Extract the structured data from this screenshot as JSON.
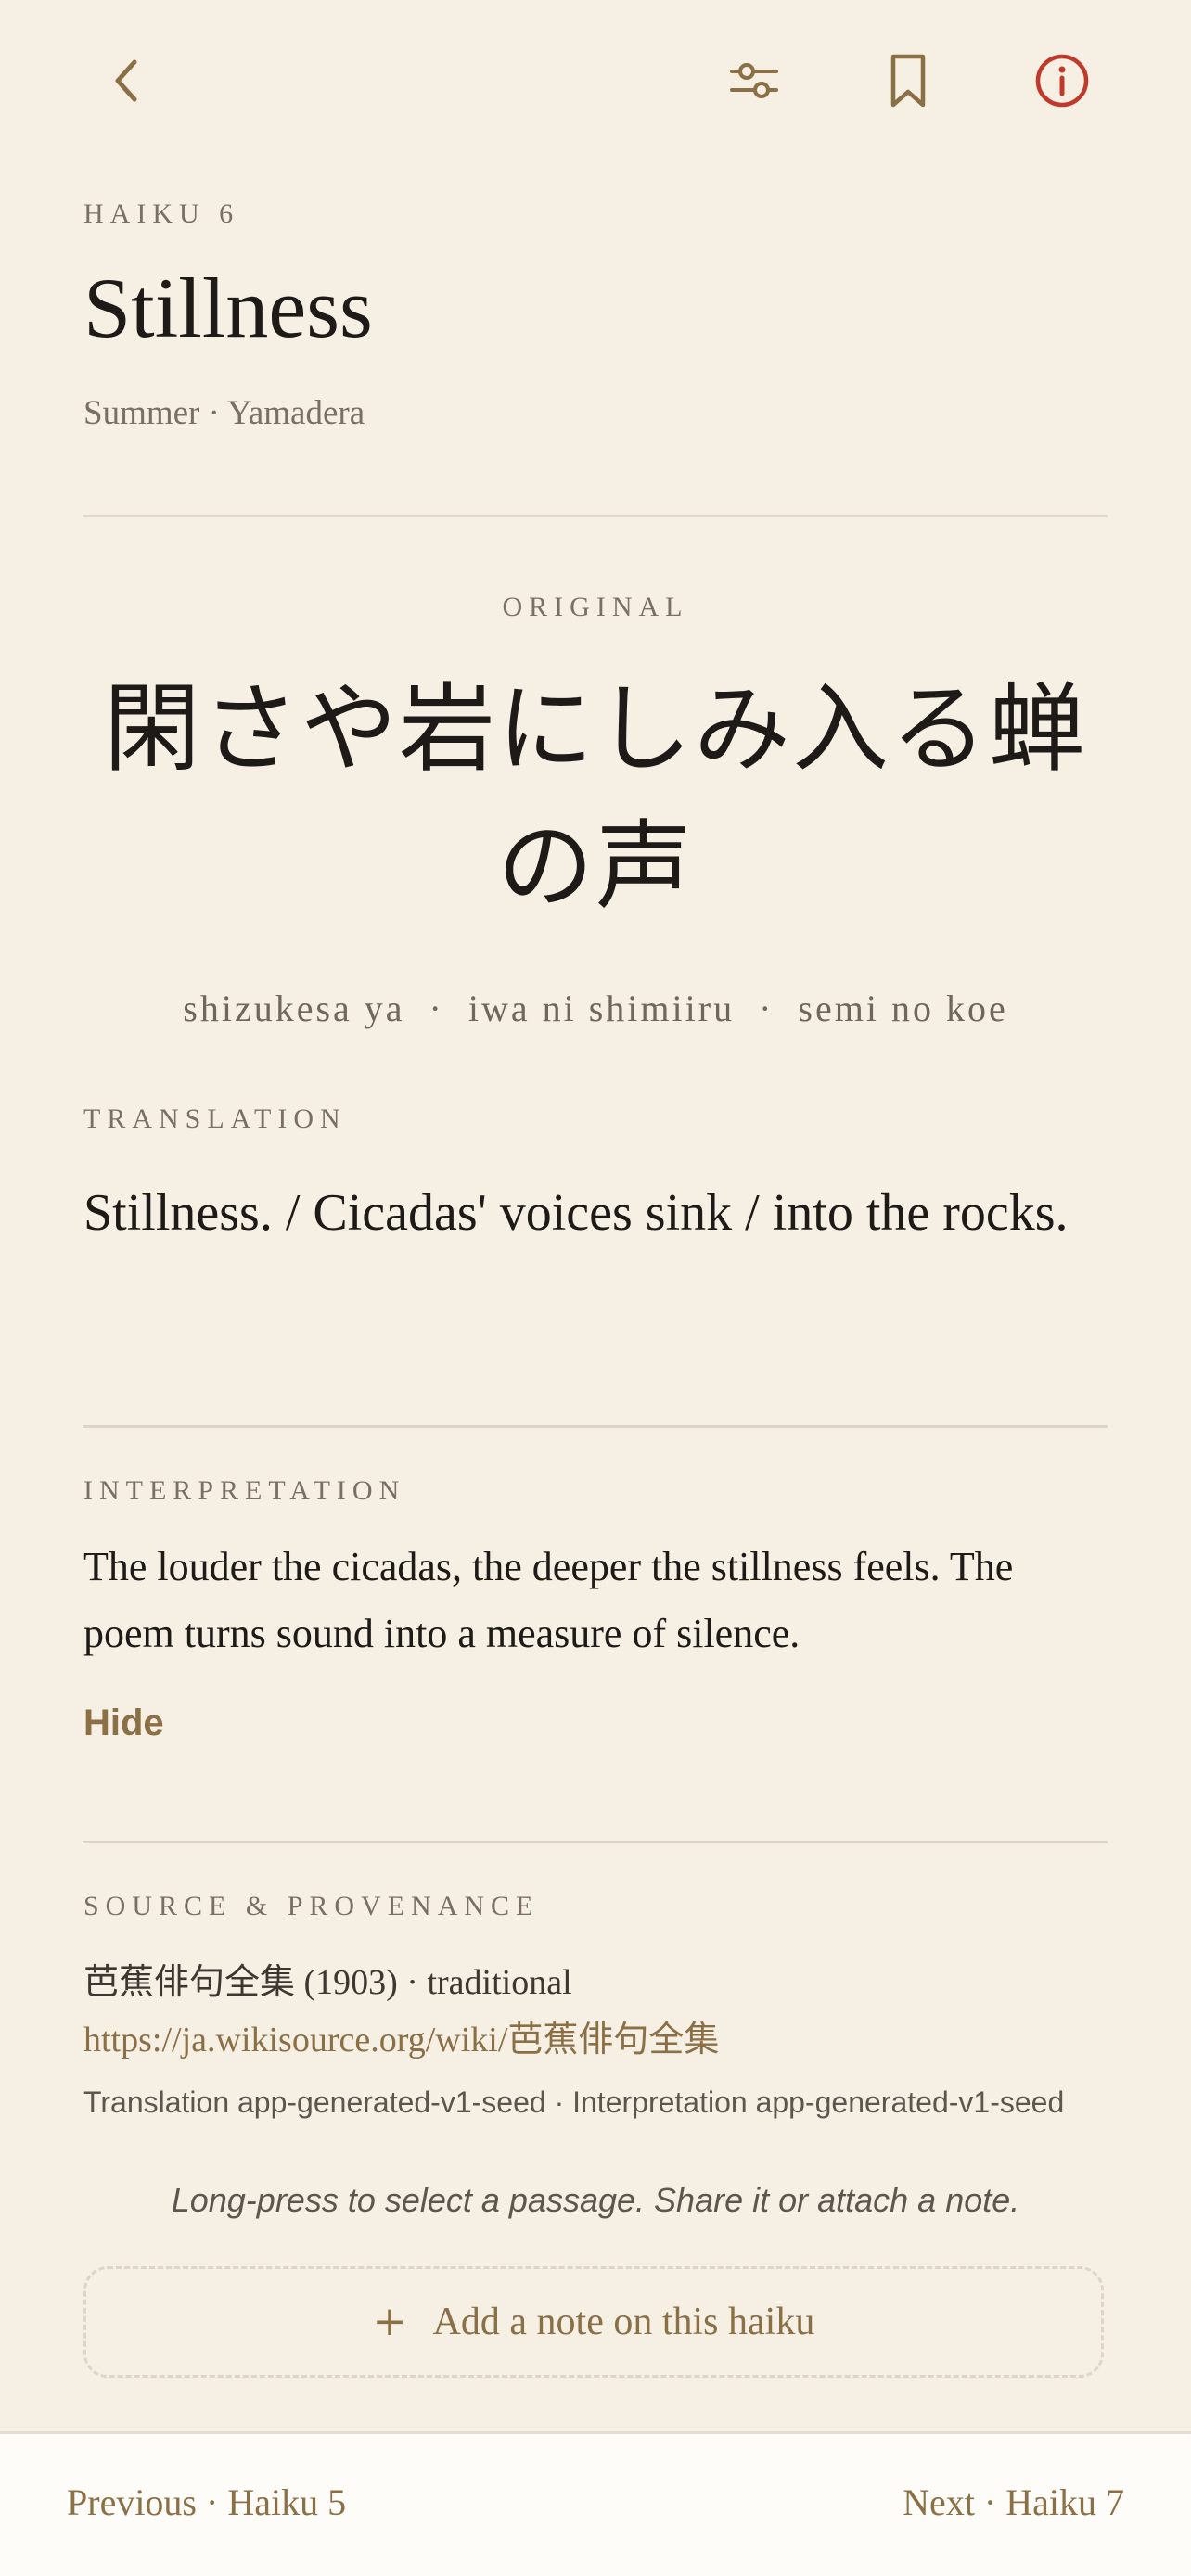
{
  "toolbar": {
    "back_icon": "chevron-left-icon",
    "settings_icon": "sliders-icon",
    "bookmark_icon": "bookmark-icon",
    "info_icon": "info-icon",
    "accent_color": "#8b6f45",
    "info_color": "#c0392b"
  },
  "header": {
    "eyebrow": "HAIKU 6",
    "title": "Stillness",
    "subtitle": "Summer · Yamadera"
  },
  "original": {
    "label": "ORIGINAL",
    "line1": "閑さや岩にしみ入る蝉",
    "line2": "の声",
    "romaji": "shizukesa ya  ·  iwa ni shimiiru  ·  semi no koe"
  },
  "translation": {
    "label": "TRANSLATION",
    "text": "Stillness. / Cicadas' voices sink / into the rocks."
  },
  "interpretation": {
    "label": "INTERPRETATION",
    "line1": "The louder the cicadas, the deeper the stillness feels. The",
    "line2": "poem turns sound into a measure of silence.",
    "hide_label": "Hide"
  },
  "source": {
    "label": "SOURCE & PROVENANCE",
    "citation": "芭蕉俳句全集 (1903) · traditional",
    "url": "https://ja.wikisource.org/wiki/芭蕉俳句全集",
    "meta": "Translation app-generated-v1-seed · Interpretation app-generated-v1-seed"
  },
  "hint": "Long-press to select a passage. Share it or attach a note.",
  "add_note": {
    "icon": "plus-icon",
    "label": "Add a note on this haiku"
  },
  "footer": {
    "previous": "Previous · Haiku 5",
    "next": "Next · Haiku 7"
  }
}
